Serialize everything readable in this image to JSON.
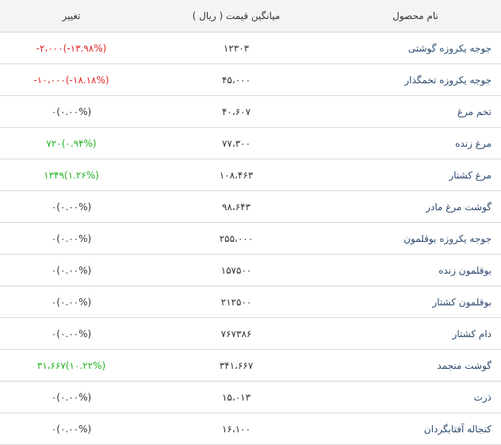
{
  "header": {
    "product": "نام محصول",
    "price": "میانگین قیمت ( ریال )",
    "change": "تغییر"
  },
  "colors": {
    "negative": "#e02424",
    "positive": "#21b321",
    "neutral": "#333333",
    "name_text": "#2c4a6e"
  },
  "rows": [
    {
      "name": "جوجه یکروزه گوشتی",
      "price": "۱۲۳۰۳",
      "change": "-۲،۰۰۰(-۱۳.۹۸%)",
      "trend": "negative"
    },
    {
      "name": "جوجه یکروزه تخمگذار",
      "price": "۴۵،۰۰۰",
      "change": "-۱۰،۰۰۰(-۱۸.۱۸%)",
      "trend": "negative"
    },
    {
      "name": "تخم مرغ",
      "price": "۴۰،۶۰۷",
      "change": "۰(۰.۰۰%)",
      "trend": "neutral"
    },
    {
      "name": "مرغ زنده",
      "price": "۷۷،۳۰۰",
      "change": "۷۲۰(۰.۹۴%)",
      "trend": "positive"
    },
    {
      "name": "مرغ کشتار",
      "price": "۱۰۸،۴۶۳",
      "change": "۱۳۴۹(۱.۲۶%)",
      "trend": "positive"
    },
    {
      "name": "گوشت مرغ مادر",
      "price": "۹۸،۶۴۳",
      "change": "۰(۰.۰۰%)",
      "trend": "neutral"
    },
    {
      "name": "جوجه یکروزه بوقلمون",
      "price": "۲۵۵،۰۰۰",
      "change": "۰(۰.۰۰%)",
      "trend": "neutral"
    },
    {
      "name": "بوقلمون زنده",
      "price": "۱۵۷۵۰۰",
      "change": "۰(۰.۰۰%)",
      "trend": "neutral"
    },
    {
      "name": "بوقلمون کشتار",
      "price": "۲۱۲۵۰۰",
      "change": "۰(۰.۰۰%)",
      "trend": "neutral"
    },
    {
      "name": "دام کشتار",
      "price": "۷۶۷۳۸۶",
      "change": "۰(۰.۰۰%)",
      "trend": "neutral"
    },
    {
      "name": "گوشت منجمد",
      "price": "۳۴۱،۶۶۷",
      "change": "۳۱،۶۶۷(۱۰.۲۲%)",
      "trend": "positive"
    },
    {
      "name": "ذرت",
      "price": "۱۵،۰۱۳",
      "change": "۰(۰.۰۰%)",
      "trend": "neutral"
    },
    {
      "name": "کنجاله آفتابگردان",
      "price": "۱۶،۱۰۰",
      "change": "۰(۰.۰۰%)",
      "trend": "neutral"
    }
  ]
}
